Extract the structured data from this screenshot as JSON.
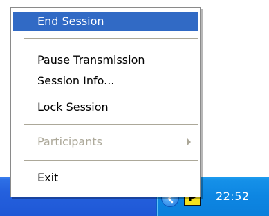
{
  "menu": {
    "items": [
      {
        "label": "End Session"
      },
      {
        "label": "Pause Transmission"
      },
      {
        "label": "Session Info..."
      },
      {
        "label": "Lock Session"
      },
      {
        "label": "Participants"
      },
      {
        "label": "Exit"
      }
    ]
  },
  "tray": {
    "p_icon_label": "P",
    "clock": "22:52",
    "icons": [
      "chevron-left-icon",
      "p-app-icon"
    ]
  },
  "colors": {
    "highlight": "#316ac5",
    "taskbar": "#245edc",
    "tray": "#0f86e2",
    "disabled_text": "#aca899"
  }
}
